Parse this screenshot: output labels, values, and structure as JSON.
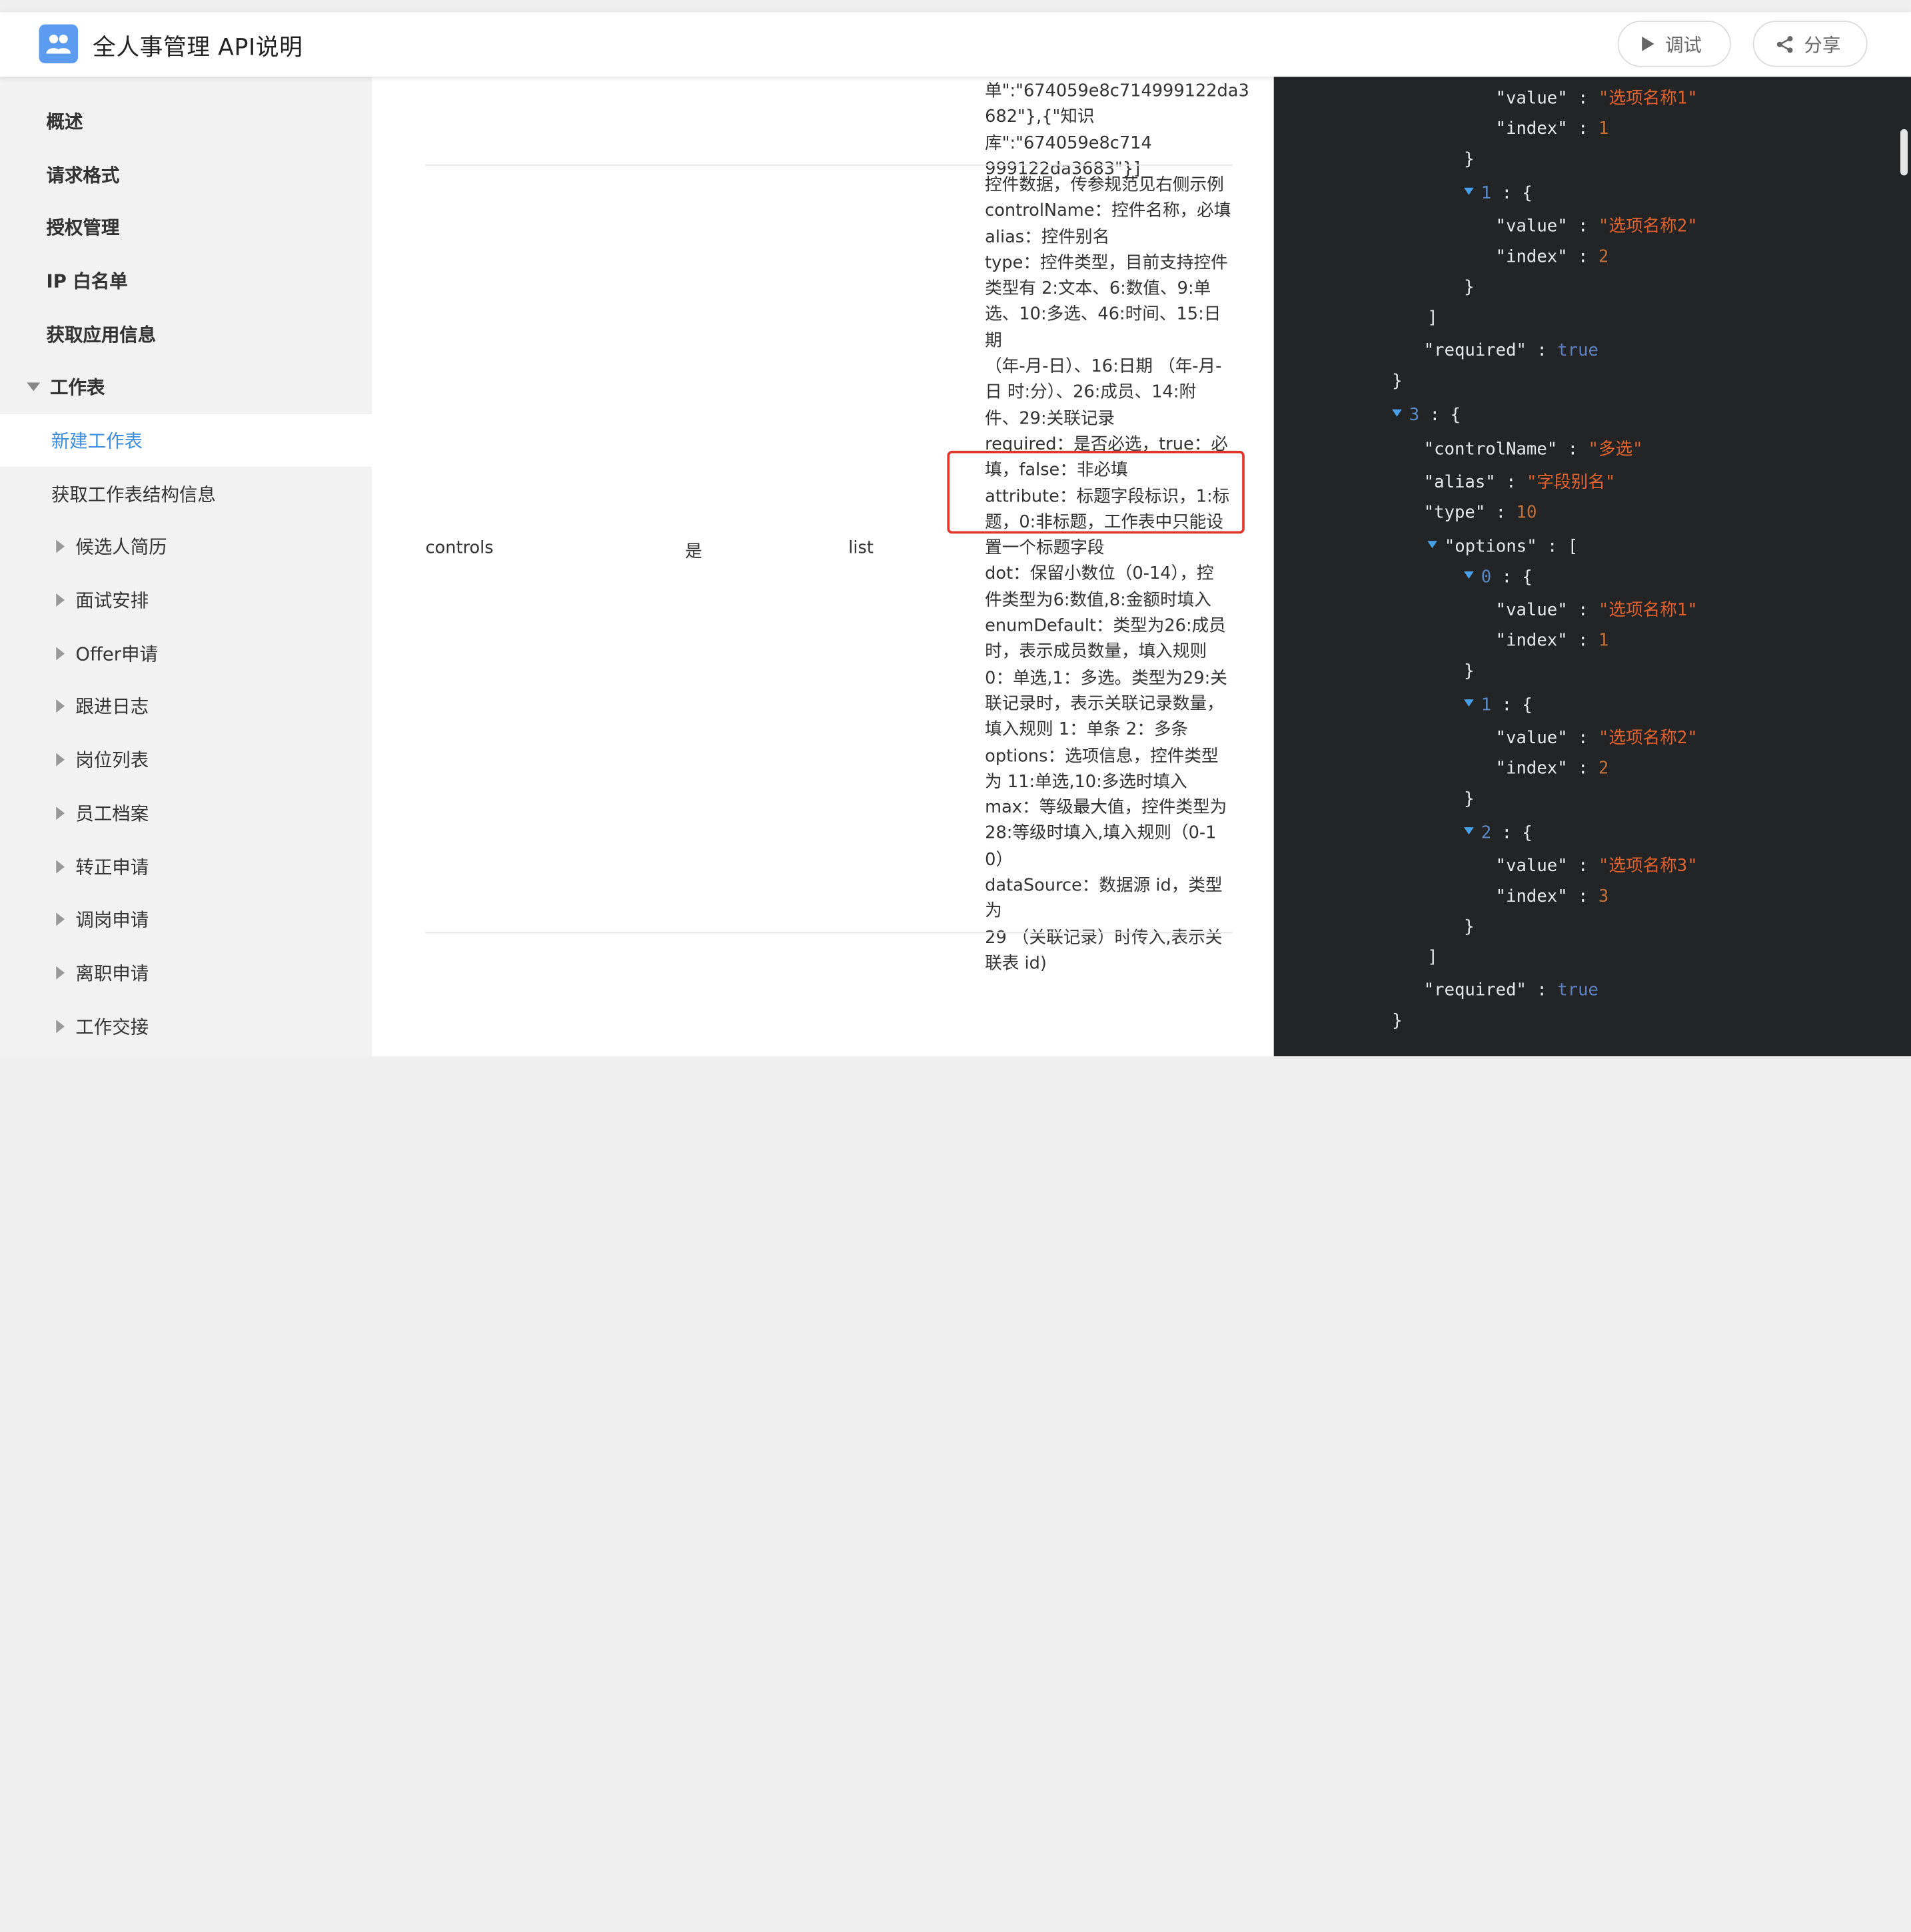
{
  "header": {
    "title": "全人事管理 API说明",
    "debug_label": "调试",
    "share_label": "分享"
  },
  "sidebar": {
    "items": [
      {
        "label": "概述"
      },
      {
        "label": "请求格式"
      },
      {
        "label": "授权管理"
      },
      {
        "label": "IP 白名单"
      },
      {
        "label": "获取应用信息"
      },
      {
        "label": "工作表"
      },
      {
        "label": "新建工作表"
      },
      {
        "label": "获取工作表结构信息"
      },
      {
        "label": "候选人简历"
      },
      {
        "label": "面试安排"
      },
      {
        "label": "Offer申请"
      },
      {
        "label": "跟进日志"
      },
      {
        "label": "岗位列表"
      },
      {
        "label": "员工档案"
      },
      {
        "label": "转正申请"
      },
      {
        "label": "调岗申请"
      },
      {
        "label": "离职申请"
      },
      {
        "label": "工作交接"
      }
    ]
  },
  "params": {
    "prev_desc": [
      "单\":\"674059e8c714999122da3",
      "682\"},{\"知识库\":\"674059e8c714",
      "999122da3683\"}]"
    ],
    "row": {
      "name": "controls",
      "required": "是",
      "type": "list",
      "desc": [
        "控件数据，传参规范见右侧示例",
        "controlName：控件名称，必填",
        "alias：控件别名",
        "type：控件类型，目前支持控件",
        "类型有 2:文本、6:数值、9:单",
        "选、10:多选、46:时间、15:日期",
        "（年-月-日）、16:日期 （年-月-",
        "日 时:分）、26:成员、14:附",
        "件、29:关联记录",
        "required：是否必选，true：必",
        "填，false：非必填",
        "attribute：标题字段标识，1:标",
        "题，0:非标题，工作表中只能设",
        "置一个标题字段",
        "dot：保留小数位（0-14），控",
        "件类型为6:数值,8:金额时填入",
        "enumDefault：类型为26:成员",
        "时，表示成员数量，填入规则",
        "0：单选,1：多选。类型为29:关",
        "联记录时，表示关联记录数量，",
        "填入规则 1：单条 2：多条",
        "options：选项信息，控件类型",
        "为 11:单选,10:多选时填入",
        "max：等级最大值，控件类型为",
        "28:等级时填入,填入规则（0-1",
        "0）",
        "dataSource：数据源 id，类型为",
        "29 （关联记录）时传入,表示关",
        "联表 id)"
      ]
    }
  },
  "code": {
    "k_value": "\"value\"",
    "k_index": "\"index\"",
    "k_required": "\"required\"",
    "k_controlName": "\"controlName\"",
    "k_alias": "\"alias\"",
    "k_type": "\"type\"",
    "k_options": "\"options\"",
    "v_opt1": "\"选项名称1\"",
    "v_opt2": "\"选项名称2\"",
    "v_opt3": "\"选项名称3\"",
    "v_multi": "\"多选\"",
    "v_alias": "\"字段别名\"",
    "v_type": "10",
    "n1": "1",
    "n2": "2",
    "n3": "3",
    "v_true": "true",
    "i0": "0",
    "i1": "1",
    "i2": "2",
    "i3": "3"
  }
}
